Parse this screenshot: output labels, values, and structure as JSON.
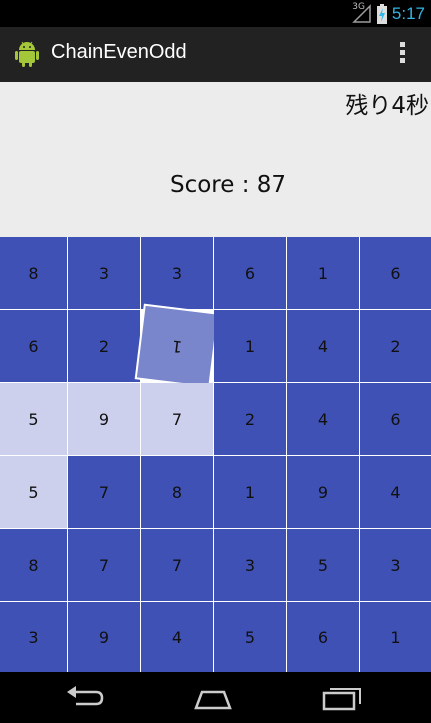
{
  "status_bar": {
    "network": "3G",
    "time": "5:17",
    "colors": {
      "time": "#33b5e5"
    }
  },
  "action_bar": {
    "title": "ChainEvenOdd",
    "icon": "android-icon",
    "menu_icon": "overflow-menu-icon"
  },
  "game": {
    "remaining": "残り4秒",
    "score_label": "Score : 87",
    "grid": [
      [
        "8",
        "3",
        "3",
        "6",
        "1",
        "6"
      ],
      [
        "6",
        "2",
        "1",
        "1",
        "4",
        "2"
      ],
      [
        "5",
        "9",
        "7",
        "2",
        "4",
        "6"
      ],
      [
        "5",
        "7",
        "8",
        "1",
        "9",
        "4"
      ],
      [
        "8",
        "7",
        "7",
        "3",
        "5",
        "3"
      ],
      [
        "3",
        "9",
        "4",
        "5",
        "6",
        "1"
      ]
    ],
    "colors": {
      "tile": "#3f51b5",
      "chained": "#cdd0ec",
      "selected": "#7986cb",
      "background": "#ececec"
    }
  },
  "nav_bar": {
    "back": "back-icon",
    "home": "home-icon",
    "recents": "recent-apps-icon"
  }
}
